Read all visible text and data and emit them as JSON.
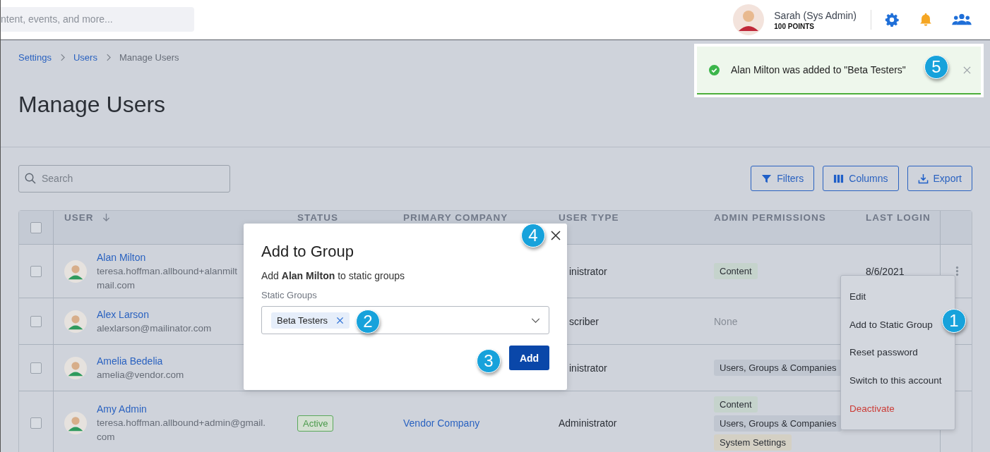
{
  "top_bar": {
    "search": {
      "placeholder": "ntent, events, and more..."
    },
    "user": {
      "name": "Sarah (Sys Admin)",
      "points": "100 POINTS"
    }
  },
  "breadcrumb": [
    {
      "label": "Settings",
      "kind": "link"
    },
    {
      "label": "Users",
      "kind": "link"
    },
    {
      "label": "Manage Users",
      "kind": "current"
    }
  ],
  "page_title": "Manage Users",
  "search": {
    "placeholder": "Search"
  },
  "toolbar_buttons": [
    {
      "label": "Filters",
      "kind": "filter"
    },
    {
      "label": "Columns",
      "kind": "columns"
    },
    {
      "label": "Export",
      "kind": "export"
    }
  ],
  "table": {
    "all_selected": false,
    "columns": [
      {
        "label": "USER",
        "sorted": true
      },
      {
        "label": "STATUS"
      },
      {
        "label": "PRIMARY COMPANY"
      },
      {
        "label": "USER TYPE"
      },
      {
        "label": "ADMIN PERMISSIONS"
      },
      {
        "label": "LAST LOGIN"
      }
    ],
    "rows": [
      {
        "selected": false,
        "name": "Alan Milton",
        "email_lines": [
          "teresa.hoffman.allbound+alanmilt",
          "mail.com"
        ],
        "covered": true,
        "user_type": "inistrator",
        "permissions": [
          {
            "label": "Content",
            "color": "#c5d3cc"
          }
        ],
        "last_login": "8/6/2021",
        "more_button": true
      },
      {
        "selected": false,
        "name": "Alex Larson",
        "email_lines": [
          "alexlarson@mailinator.com"
        ],
        "covered": true,
        "user_type": "scriber",
        "permissions_text": "None",
        "more_button": false
      },
      {
        "selected": false,
        "name": "Amelia Bedelia",
        "email_lines": [
          "amelia@vendor.com"
        ],
        "covered": true,
        "user_type": "inistrator",
        "permissions": [
          {
            "label": "Users, Groups & Companies",
            "color": "#c0c6d0"
          }
        ],
        "more_button": false
      },
      {
        "selected": false,
        "name": "Amy Admin",
        "email_lines": [
          "teresa.hoffman.allbound+admin@gmail.",
          "com"
        ],
        "status": "Active",
        "company": "Vendor Company",
        "user_type": "Administrator",
        "permissions": [
          {
            "label": "Content",
            "color": "#c5d3cc"
          },
          {
            "label": "Users, Groups & Companies",
            "color": "#c0c6d0"
          },
          {
            "label": "System Settings",
            "color": "#d4d0c4"
          }
        ],
        "more_button": false
      }
    ]
  },
  "dialog": {
    "title": "Add to Group",
    "description": "Add **Alan Milton** to static groups",
    "field_label": "Static Groups",
    "chips": [
      "Beta Testers"
    ],
    "primary_button": "Add"
  },
  "row_menu": [
    {
      "label": "Edit",
      "kind": "normal"
    },
    {
      "label": "Add to Static Group",
      "kind": "normal"
    },
    {
      "label": "Reset password",
      "kind": "normal"
    },
    {
      "label": "Switch to this account",
      "kind": "normal"
    },
    {
      "label": "Deactivate",
      "kind": "danger"
    }
  ],
  "toast": {
    "message": "Alan Milton was added to \"Beta Testers\""
  },
  "callouts": [
    "1",
    "2",
    "3",
    "4",
    "5"
  ]
}
